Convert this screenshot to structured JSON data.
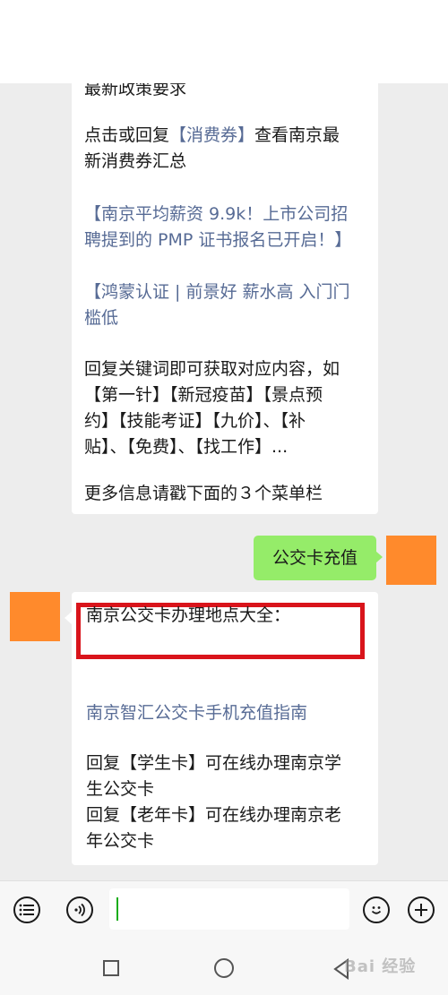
{
  "message1": {
    "line_cut": "最新政策要求",
    "consumer_prefix": "点击或回复",
    "consumer_link": "【消费券】",
    "consumer_suffix": "查看南京最",
    "consumer_line2": "新消费券汇总",
    "article1_line1": "【南京平均薪资 9.9k！上市公司招",
    "article1_line2": "聘提到的 PMP 证书报名已开启！】",
    "article2_line1": "【鸿蒙认证 | 前景好 薪水高 入门门",
    "article2_line2": "槛低",
    "keywords_line1": "回复关键词即可获取对应内容，如",
    "keywords_line2": "【第一针】【新冠疫苗】【景点预",
    "keywords_line3": "约】【技能考证】【九价】、【补",
    "keywords_line4": "贴】、【免费】、【找工作】...",
    "menu_hint": "更多信息请戳下面的３个菜单栏"
  },
  "user_message": {
    "text": "公交卡充值"
  },
  "message2": {
    "title": "南京公交卡办理地点大全：",
    "link": "南京智汇公交卡手机充值指南",
    "student_line1": "回复【学生卡】可在线办理南京学",
    "student_line2": "生公交卡",
    "elder_line1": "回复【老年卡】可在线办理南京老",
    "elder_line2": "年公交卡"
  },
  "input_bar": {
    "left_icons": [
      "list-icon",
      "voice-icon"
    ],
    "right_icons": [
      "emoji-icon",
      "plus-icon"
    ],
    "value": ""
  },
  "nav_bar": {
    "icons": [
      "recent-apps-icon",
      "home-icon",
      "back-icon"
    ]
  },
  "watermark": {
    "text": "Bai 经验"
  },
  "colors": {
    "user_bubble": "#95ec69",
    "link": "#576b95",
    "highlight": "#d9141b",
    "avatar": "#ff8a2c"
  }
}
